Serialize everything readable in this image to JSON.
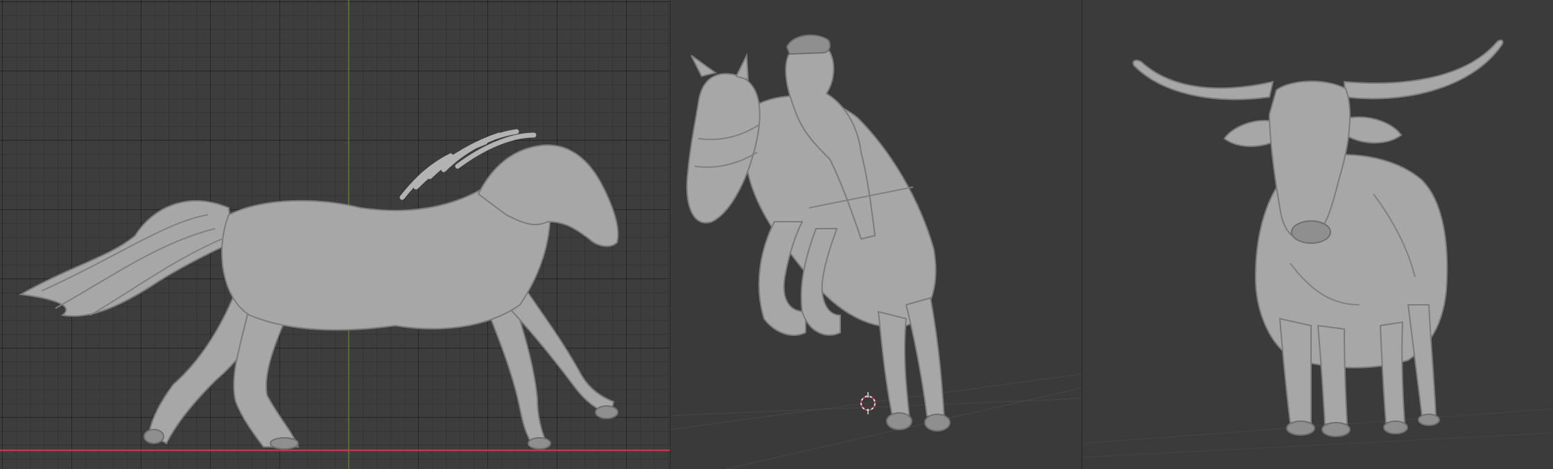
{
  "app": {
    "accent_x_axis": "#c0394a",
    "accent_y_axis": "#6b9e2f"
  },
  "viewports": [
    {
      "id": "left",
      "view": "orthographic",
      "background": "#3d3d3d",
      "grid": true,
      "object": "running-horse"
    },
    {
      "id": "middle",
      "view": "perspective",
      "background": "#3a3a3a",
      "grid": false,
      "object": "jumping-horse-with-jockey"
    },
    {
      "id": "right",
      "view": "perspective",
      "background": "#3b3b3b",
      "grid": false,
      "object": "longhorn-bull"
    }
  ],
  "icons": {
    "cursor": "3d-cursor-icon"
  },
  "colors": {
    "sculpt": "#a7a7a7",
    "sculpt_shadow": "#7c7c7c"
  }
}
